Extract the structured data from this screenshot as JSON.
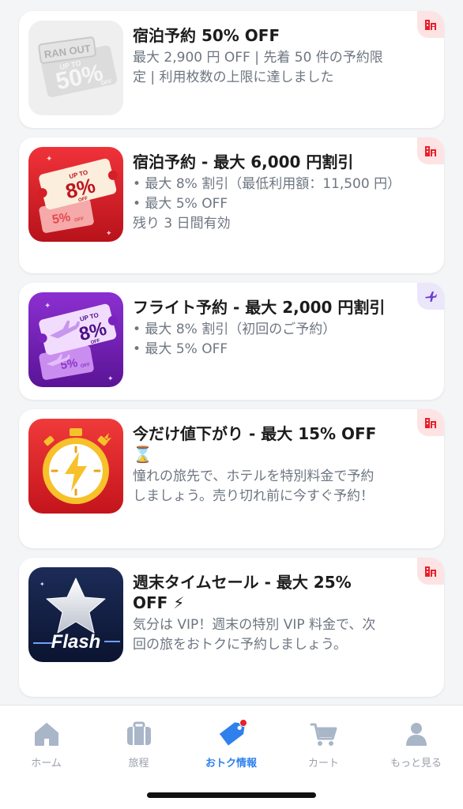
{
  "deals": [
    {
      "title": "宿泊予約 50% OFF",
      "lines": [
        "最大 2,900 円 OFF | 先着 50 件の予約限",
        "定 | 利用枚数の上限に達しました"
      ],
      "category": "hotel-icon",
      "thumb_text": {
        "ranout": "RAN OUT",
        "upto": "UP TO",
        "pct": "50%",
        "off": "OFF"
      }
    },
    {
      "title": "宿泊予約 - 最大 6,000 円割引",
      "lines": [
        "• 最大 8% 割引（最低利用額：11,500 円）",
        "• 最大 5% OFF",
        "残り 3 日間有効"
      ],
      "category": "hotel-icon",
      "thumb_text": {
        "upto": "UP TO",
        "pct": "8%",
        "off": "OFF",
        "pct2": "5%",
        "off2": "OFF"
      }
    },
    {
      "title": "フライト予約 - 最大 2,000 円割引",
      "lines": [
        "• 最大 8% 割引（初回のご予約）",
        "• 最大 5% OFF"
      ],
      "category": "plane-icon",
      "thumb_text": {
        "upto": "UP TO",
        "pct": "8%",
        "off": "OFF",
        "pct2": "5%",
        "off2": "OFF"
      }
    },
    {
      "title_line1": "今だけ値下がり - 最大 15% OFF",
      "title_line2": "⌛",
      "lines": [
        "憧れの旅先で、ホテルを特別料金で予約",
        "しましょう。売り切れ前に今すぐ予約！"
      ],
      "category": "hotel-icon"
    },
    {
      "title_line1": "週末タイムセール - 最大 25%",
      "title_line2": "OFF ⚡",
      "lines": [
        "気分は VIP！週末の特別 VIP 料金で、次",
        "回の旅をおトクに予約しましょう。"
      ],
      "category": "hotel-icon",
      "thumb_text": {
        "flash": "Flash"
      }
    }
  ],
  "tabbar": {
    "items": [
      {
        "label": "ホーム",
        "icon": "home-icon"
      },
      {
        "label": "旅程",
        "icon": "suitcase-icon"
      },
      {
        "label": "おトク情報",
        "icon": "tag-icon",
        "active": true
      },
      {
        "label": "カート",
        "icon": "cart-icon"
      },
      {
        "label": "もっと見る",
        "icon": "person-icon"
      }
    ]
  },
  "colors": {
    "accent": "#2f80ed",
    "hotel_badge": "#e8202a",
    "flight_badge": "#6a3fd6",
    "muted": "#9aa0aa"
  }
}
